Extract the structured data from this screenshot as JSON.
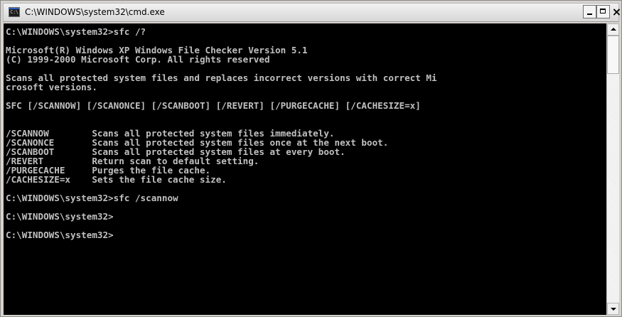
{
  "window": {
    "title": "C:\\WINDOWS\\system32\\cmd.exe",
    "icon": "cmd-icon",
    "icon_label": "C:\\",
    "buttons": {
      "minimize": "minimize-icon",
      "maximize": "maximize-icon",
      "close": "close-icon",
      "close_glyph": "×"
    }
  },
  "console": {
    "text_color": "#c0c0c0",
    "background": "#000000",
    "lines": [
      "C:\\WINDOWS\\system32>sfc /?",
      "",
      "Microsoft(R) Windows XP Windows File Checker Version 5.1",
      "(C) 1999-2000 Microsoft Corp. All rights reserved",
      "",
      "Scans all protected system files and replaces incorrect versions with correct Mi",
      "crosoft versions.",
      "",
      "SFC [/SCANNOW] [/SCANONCE] [/SCANBOOT] [/REVERT] [/PURGECACHE] [/CACHESIZE=x]",
      "",
      "",
      "/SCANNOW        Scans all protected system files immediately.",
      "/SCANONCE       Scans all protected system files once at the next boot.",
      "/SCANBOOT       Scans all protected system files at every boot.",
      "/REVERT         Return scan to default setting.",
      "/PURGECACHE     Purges the file cache.",
      "/CACHESIZE=x    Sets the file cache size.",
      "",
      "C:\\WINDOWS\\system32>sfc /scannow",
      "",
      "C:\\WINDOWS\\system32>",
      "",
      "C:\\WINDOWS\\system32>"
    ]
  },
  "scrollbar": {
    "up_icon": "scroll-up-arrow-icon",
    "down_icon": "scroll-down-arrow-icon"
  }
}
